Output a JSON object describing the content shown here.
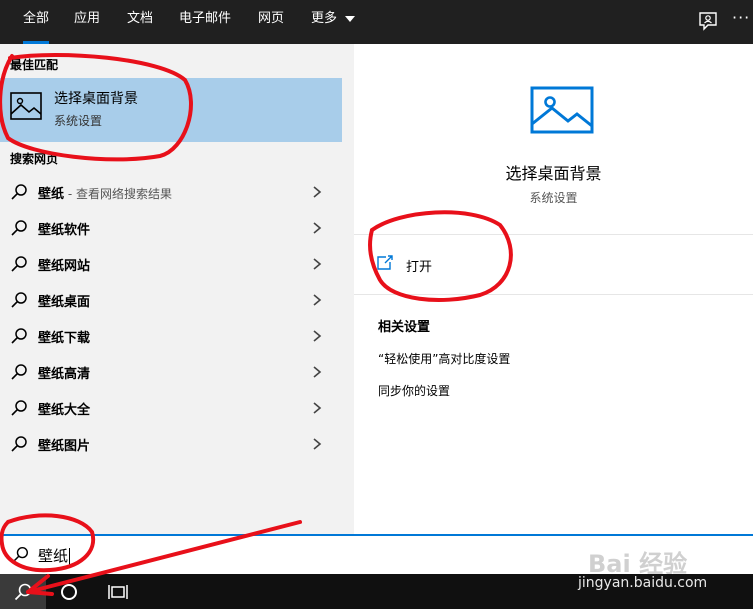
{
  "tabs": [
    {
      "label": "全部",
      "active": true
    },
    {
      "label": "应用"
    },
    {
      "label": "文档"
    },
    {
      "label": "电子邮件"
    },
    {
      "label": "网页"
    },
    {
      "label": "更多"
    }
  ],
  "left": {
    "best_match_title": "最佳匹配",
    "best_match": {
      "title": "选择桌面背景",
      "subtitle": "系统设置",
      "icon": "picture-icon"
    },
    "web_search_title": "搜索网页",
    "suggestions": [
      {
        "bold": "壁纸",
        "rest": " - 查看网络搜索结果"
      },
      {
        "bold": "壁纸软件",
        "rest": ""
      },
      {
        "bold": "壁纸网站",
        "rest": ""
      },
      {
        "bold": "壁纸桌面",
        "rest": ""
      },
      {
        "bold": "壁纸下载",
        "rest": ""
      },
      {
        "bold": "壁纸高清",
        "rest": ""
      },
      {
        "bold": "壁纸大全",
        "rest": ""
      },
      {
        "bold": "壁纸图片",
        "rest": ""
      }
    ]
  },
  "right": {
    "title": "选择桌面背景",
    "subtitle": "系统设置",
    "open_label": "打开",
    "related_title": "相关设置",
    "related_items": [
      "“轻松使用”高对比度设置",
      "同步你的设置"
    ]
  },
  "search": {
    "value": "壁纸"
  },
  "watermark": {
    "logo": "Bai 经验",
    "url": "jingyan.baidu.com"
  },
  "colors": {
    "accent": "#0078d7",
    "selection": "#a8cdea",
    "annotation": "#e8101a"
  }
}
